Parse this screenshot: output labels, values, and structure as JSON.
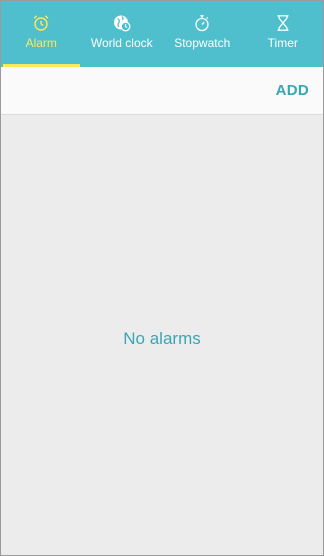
{
  "tabs": [
    {
      "label": "Alarm",
      "icon": "alarm-clock-icon",
      "active": true
    },
    {
      "label": "World clock",
      "icon": "globe-clock-icon",
      "active": false
    },
    {
      "label": "Stopwatch",
      "icon": "stopwatch-icon",
      "active": false
    },
    {
      "label": "Timer",
      "icon": "hourglass-icon",
      "active": false
    }
  ],
  "toolbar": {
    "add_label": "ADD"
  },
  "main": {
    "empty_text": "No alarms"
  },
  "colors": {
    "tabbar_bg": "#4fbfcd",
    "active_accent": "#ffe85a",
    "text_accent": "#3aa6b4",
    "content_bg": "#ececec"
  }
}
